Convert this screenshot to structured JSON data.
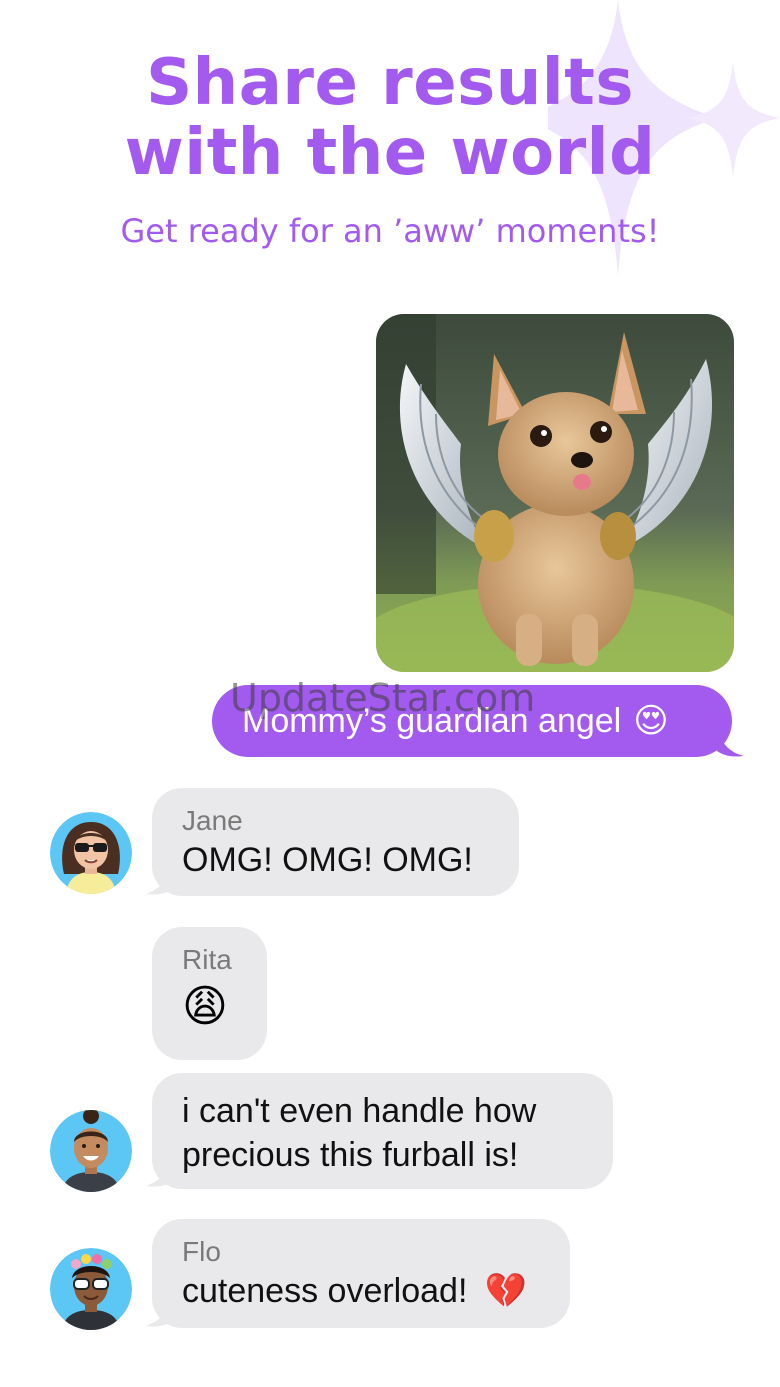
{
  "header": {
    "title_line1": "Share results",
    "title_line2": "with the world",
    "subtitle": "Get ready for an ’aww’ moments!"
  },
  "watermark": "UpdateStar.com",
  "sent_message": {
    "text": "Mommy’s guardian angel",
    "emoji": "😍"
  },
  "messages": [
    {
      "name": "Jane",
      "text": "OMG! OMG! OMG!",
      "avatar": "avatar-woman-sunglasses"
    },
    {
      "name": "Rita",
      "text": "😩",
      "avatar": ""
    },
    {
      "name": "",
      "line1": "i can't even handle how",
      "line2": "precious this furball is!",
      "avatar": "avatar-man-bun"
    },
    {
      "name": "Flo",
      "text": "cuteness overload!",
      "emoji": "💔",
      "avatar": "avatar-woman-flower-crown"
    }
  ],
  "colors": {
    "accent": "#a35bef",
    "bubble_gray": "#e9e9eb",
    "avatar_bg": "#5cc6f5"
  }
}
